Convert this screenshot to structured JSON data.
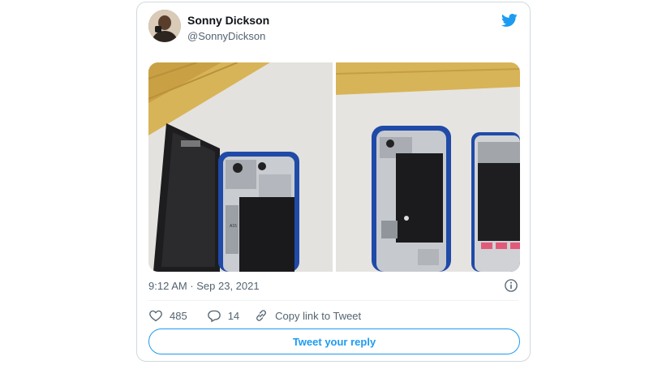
{
  "tweet": {
    "author": {
      "name": "Sonny Dickson",
      "handle": "@SonnyDickson"
    },
    "timestamp": "9:12 AM · Sep 23, 2021",
    "stats": {
      "likes": "485",
      "replies": "14"
    },
    "copy_link_label": "Copy link to Tweet",
    "reply_button_label": "Tweet your reply",
    "images": [
      {
        "icon": "photo-iphone-13-teardown-open"
      },
      {
        "icon": "photo-iphone-13-teardown-internals"
      }
    ]
  },
  "colors": {
    "brand": "#1d9bf0",
    "text_primary": "#0f1419",
    "text_secondary": "#536471",
    "border": "#cfd9de"
  }
}
